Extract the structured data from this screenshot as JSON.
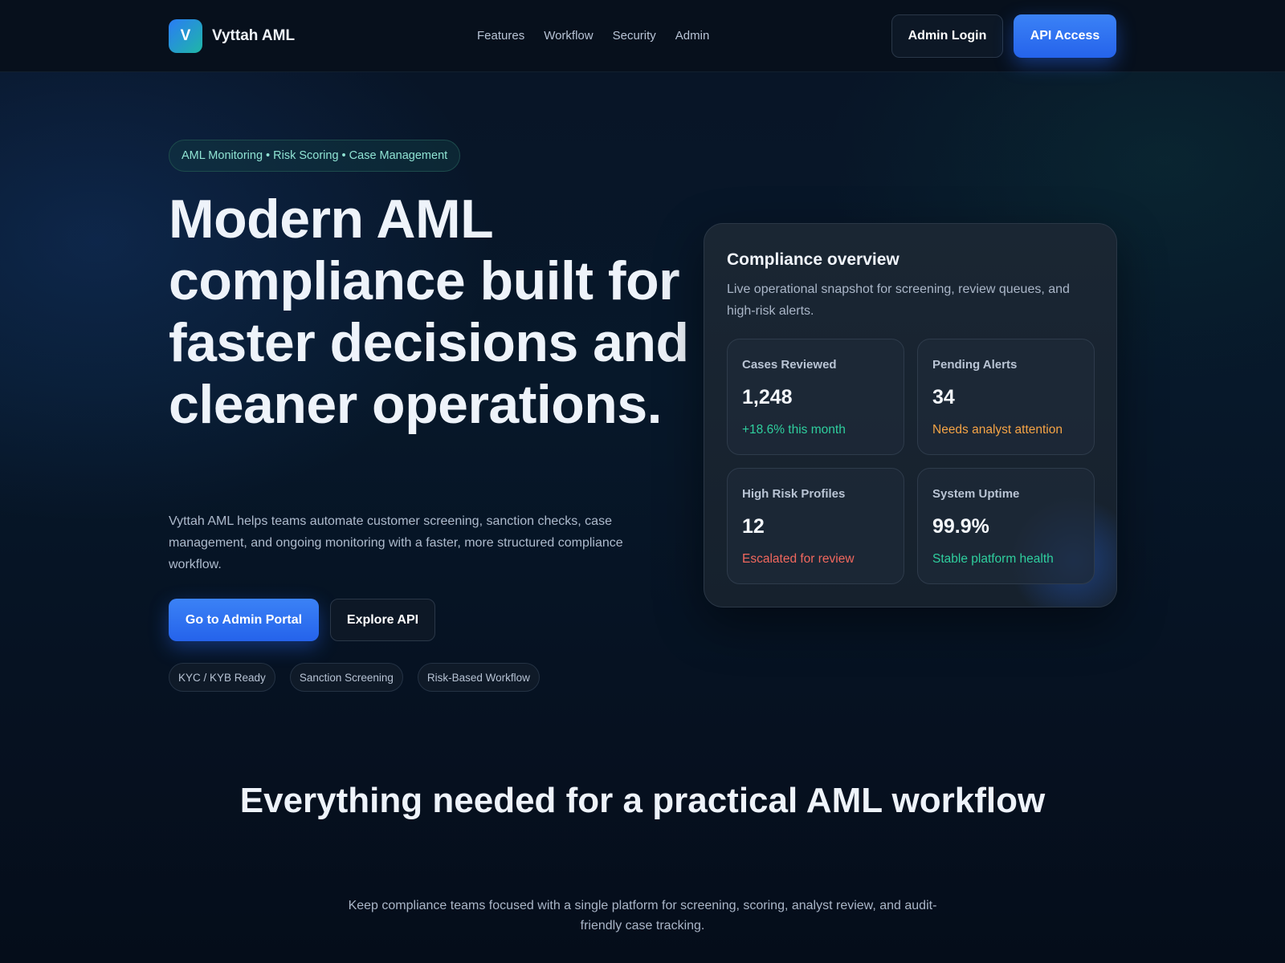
{
  "nav": {
    "logo_letter": "V",
    "brand": "Vyttah AML",
    "links": [
      "Features",
      "Workflow",
      "Security",
      "Admin"
    ],
    "admin_login": "Admin Login",
    "api_access": "API Access"
  },
  "hero": {
    "pill": "AML Monitoring • Risk Scoring • Case Management",
    "title": "Modern AML compliance built for faster decisions and cleaner operations.",
    "description": "Vyttah AML helps teams automate customer screening, sanction checks, case management, and ongoing monitoring with a faster, more structured compliance workflow.",
    "cta_primary": "Go to Admin Portal",
    "cta_secondary": "Explore API",
    "tags": [
      "KYC / KYB Ready",
      "Sanction Screening",
      "Risk-Based Workflow"
    ]
  },
  "overview": {
    "title": "Compliance overview",
    "subtitle": "Live operational snapshot for screening, review queues, and high-risk alerts.",
    "stats": [
      {
        "label": "Cases Reviewed",
        "value": "1,248",
        "note": "+18.6% this month",
        "note_color": "#2fcf9e"
      },
      {
        "label": "Pending Alerts",
        "value": "34",
        "note": "Needs analyst attention",
        "note_color": "#f5a446"
      },
      {
        "label": "High Risk Profiles",
        "value": "12",
        "note": "Escalated for review",
        "note_color": "#f2685e"
      },
      {
        "label": "System Uptime",
        "value": "99.9%",
        "note": "Stable platform health",
        "note_color": "#2fcf9e"
      }
    ]
  },
  "section": {
    "title": "Everything needed for a practical AML workflow",
    "description": "Keep compliance teams focused with a single platform for screening, scoring, analyst review, and audit-friendly case tracking."
  },
  "colors": {
    "accent": "#2563eb",
    "teal": "#1fb7a6",
    "background": "#060f1c"
  }
}
